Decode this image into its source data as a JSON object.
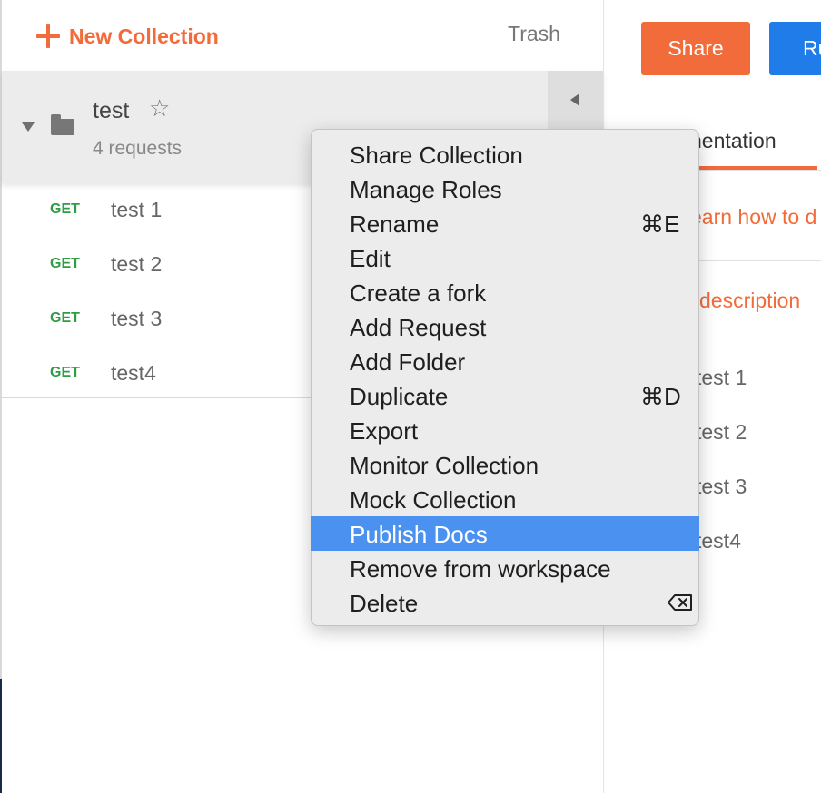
{
  "sidebar": {
    "new_collection_label": "New Collection",
    "trash_label": "Trash",
    "collection": {
      "name": "test",
      "count": "4 requests"
    },
    "requests": [
      {
        "method": "GET",
        "name": "test 1"
      },
      {
        "method": "GET",
        "name": "test 2"
      },
      {
        "method": "GET",
        "name": "test 3"
      },
      {
        "method": "GET",
        "name": "test4"
      }
    ]
  },
  "header": {
    "share_label": "Share",
    "run_label": "Ru"
  },
  "docs": {
    "tab_label": "nentation",
    "learn_link": "earn how to d",
    "description_link": "description",
    "items": [
      "test 1",
      "test 2",
      "test 3",
      "test4"
    ]
  },
  "context_menu": {
    "items": [
      {
        "label": "Share Collection",
        "shortcut": ""
      },
      {
        "label": "Manage Roles",
        "shortcut": ""
      },
      {
        "label": "Rename",
        "shortcut": "⌘E"
      },
      {
        "label": "Edit",
        "shortcut": ""
      },
      {
        "label": "Create a fork",
        "shortcut": ""
      },
      {
        "label": "Add Request",
        "shortcut": ""
      },
      {
        "label": "Add Folder",
        "shortcut": ""
      },
      {
        "label": "Duplicate",
        "shortcut": "⌘D"
      },
      {
        "label": "Export",
        "shortcut": ""
      },
      {
        "label": "Monitor Collection",
        "shortcut": ""
      },
      {
        "label": "Mock Collection",
        "shortcut": ""
      },
      {
        "label": "Publish Docs",
        "shortcut": ""
      },
      {
        "label": "Remove from workspace",
        "shortcut": ""
      },
      {
        "label": "Delete",
        "shortcut": ""
      }
    ],
    "selected_item": "Publish Docs",
    "delete_shortcut_icon": "delete-key-icon"
  },
  "colors": {
    "accent_orange": "#f26b3a",
    "primary_blue": "#1f7ce8",
    "method_get_green": "#2e9d43",
    "menu_highlight": "#4b92f0"
  }
}
